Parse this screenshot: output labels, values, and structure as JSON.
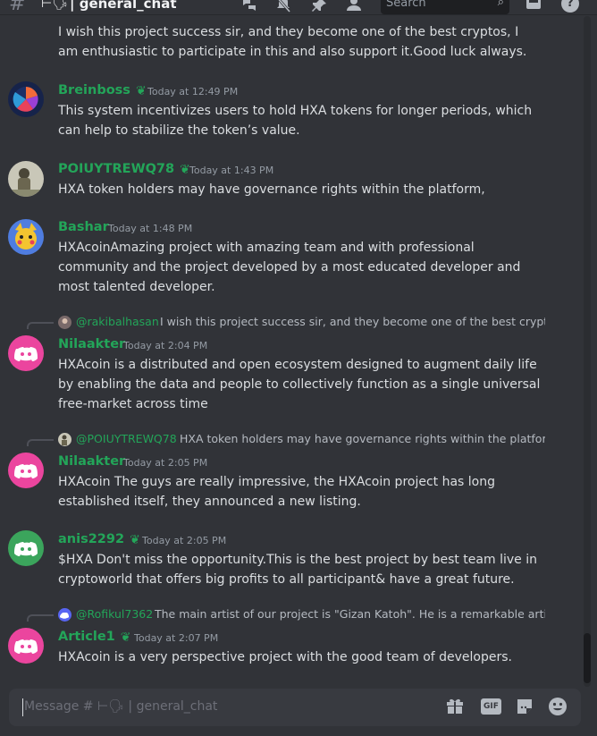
{
  "header": {
    "channel_emoji": "⊢🗣",
    "channel_name": "| general_chat",
    "search_placeholder": "Search",
    "icons": [
      "threads-icon",
      "mute-bell-icon",
      "pin-icon",
      "members-icon",
      "search-icon",
      "inbox-icon",
      "help-icon"
    ]
  },
  "messages": [
    {
      "continuation": true,
      "text": "I wish this project success sir, and they become one of the best cryptos, I am enthusiastic to participate in this and also support it.Good luck always."
    },
    {
      "author": "Breinboss",
      "badge": "❦",
      "timestamp": "Today at 12:49 PM",
      "text": "This system incentivizes users to hold HXA tokens for longer periods, which can help to stabilize the token’s value."
    },
    {
      "author": "POIUYTREWQ78",
      "badge": "❦",
      "timestamp": "Today at 1:43 PM",
      "text": "HXA token holders may have governance rights within the platform,"
    },
    {
      "author": "Bashar",
      "timestamp": "Today at 1:48 PM",
      "text": "HXAcoinAmazing project with amazing team and with professional community and the project developed by a most educated developer and most talented developer."
    },
    {
      "reply_to": {
        "author": "@rakibalhasan",
        "text": "I wish this project success sir, and they become one of the best cryptos,"
      },
      "author": "Nilaakter",
      "timestamp": "Today at 2:04 PM",
      "text": "HXAcoin is a distributed and open ecosystem designed to augment daily life by enabling the data and people to collectively function as a single universal free-market across time"
    },
    {
      "reply_to": {
        "author": "@POIUYTREWQ78",
        "text": "HXA token holders may have governance rights within the platform,"
      },
      "author": "Nilaakter",
      "timestamp": "Today at 2:05 PM",
      "text": "HXAcoin The guys are really impressive, the HXAcoin project has long established itself, they announced a new listing."
    },
    {
      "author": "anis2292",
      "badge": "❦",
      "timestamp": "Today at 2:05 PM",
      "text": "$HXA Don't miss the opportunity.This is the best project by best team live in cryptoworld that offers big profits to all participant& have a great future."
    },
    {
      "reply_to": {
        "author": "@Rofikul7362",
        "text": "The main artist of our project is \"Gizan Katoh\". He is a remarkable artist w"
      },
      "author": "Article1",
      "badge": "❦",
      "timestamp": "Today at 2:07 PM",
      "text": "HXAcoin is a very perspective project with the good team of developers."
    }
  ],
  "composer": {
    "placeholder": "Message # ⊢🗣 | general_chat",
    "gif_label": "GIF",
    "icons": [
      "gift-icon",
      "gif-icon",
      "sticker-icon",
      "emoji-icon"
    ]
  },
  "colors": {
    "background": "#313338",
    "username_green": "#23a559",
    "discord_pink": "#eb459e",
    "discord_green": "#3ba55c",
    "discord_blurple": "#5865f2"
  }
}
